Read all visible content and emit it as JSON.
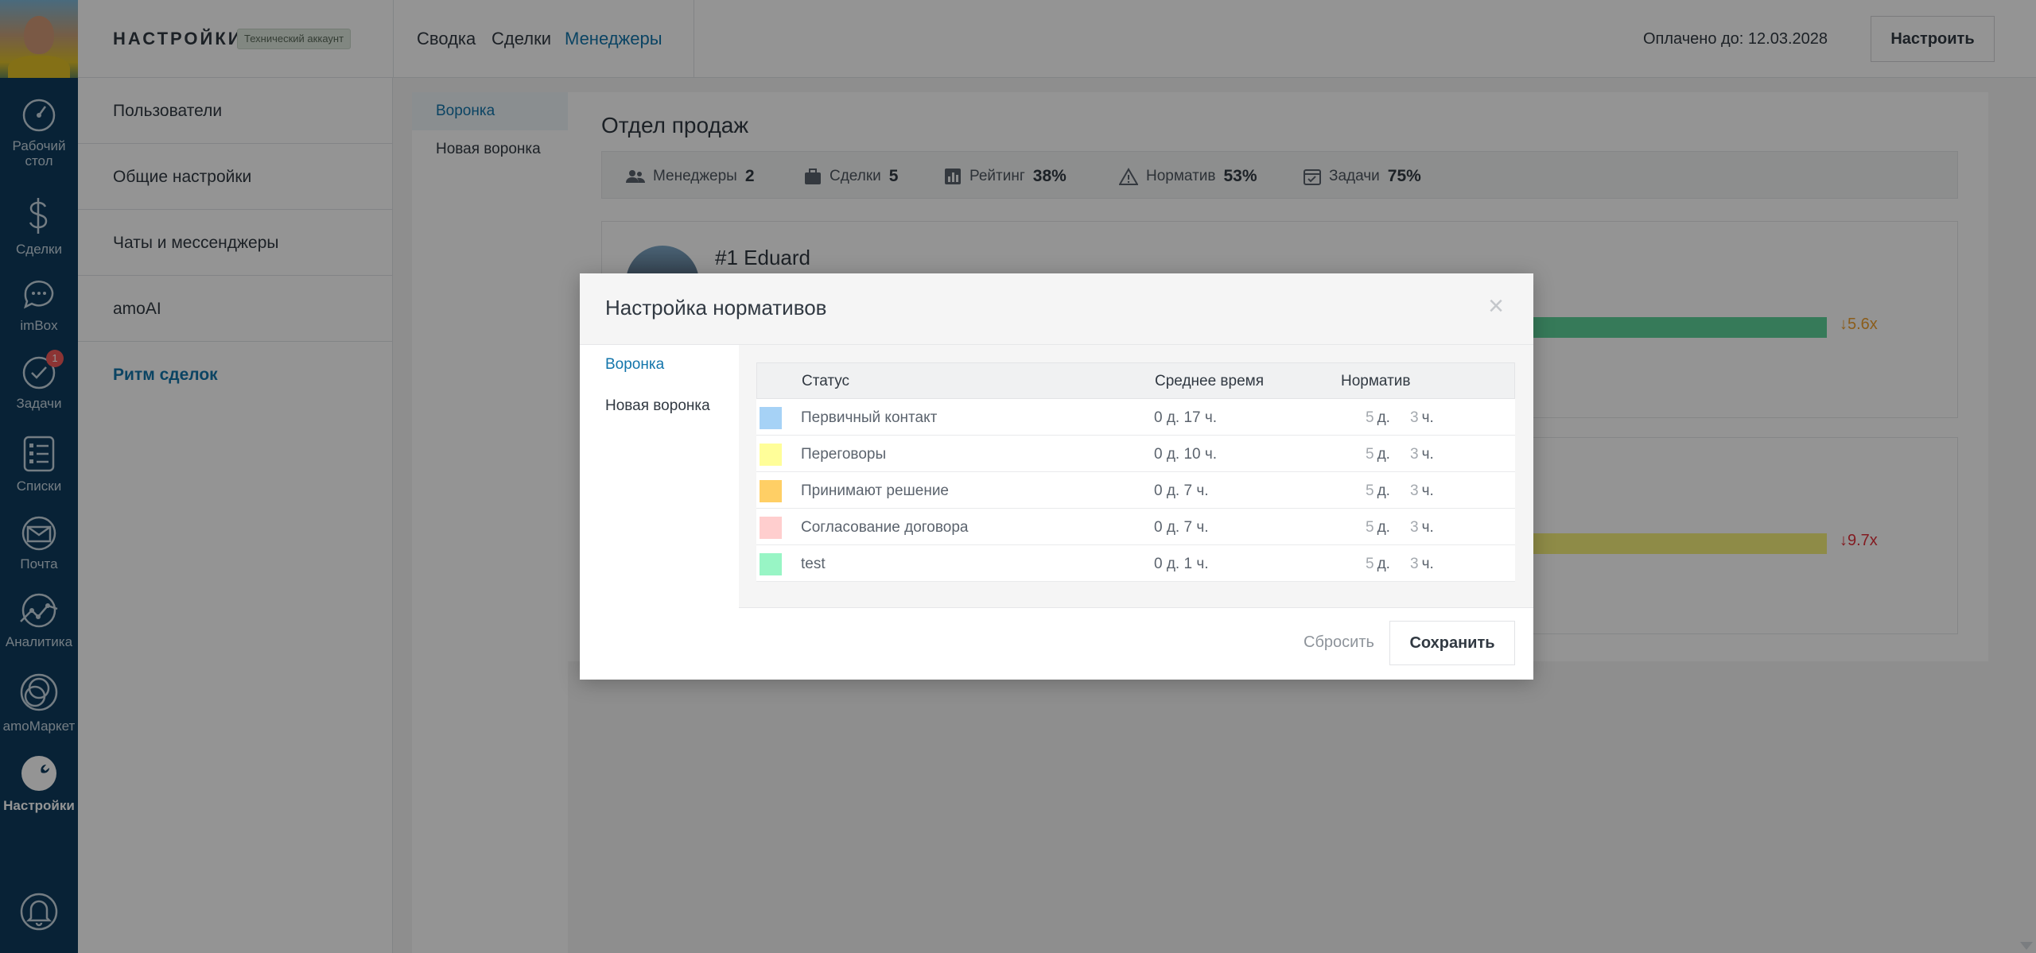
{
  "nav": {
    "items": [
      {
        "label": "Рабочий стол",
        "icon": "dashboard-gauge-icon"
      },
      {
        "label": "Сделки",
        "icon": "dollar-icon"
      },
      {
        "label": "imBox",
        "icon": "chat-bubble-icon"
      },
      {
        "label": "Задачи",
        "icon": "check-circle-icon",
        "badge": "1"
      },
      {
        "label": "Списки",
        "icon": "list-icon"
      },
      {
        "label": "Почта",
        "icon": "mail-icon"
      },
      {
        "label": "Аналитика",
        "icon": "analytics-icon"
      },
      {
        "label": "amoМаркет",
        "icon": "market-icon"
      },
      {
        "label": "Настройки",
        "icon": "wrench-icon"
      }
    ],
    "bell_icon": "bell-icon"
  },
  "header": {
    "title": "НАСТРОЙКИ",
    "account_badge": "Технический аккаунт",
    "tabs": [
      "Сводка",
      "Сделки",
      "Менеджеры"
    ],
    "active_tab": "Менеджеры",
    "paid_until": "Оплачено до: 12.03.2028",
    "configure_label": "Настроить"
  },
  "settings_menu": {
    "items": [
      "Пользователи",
      "Общие настройки",
      "Чаты и мессенджеры",
      "amoAI",
      "Ритм сделок"
    ],
    "active": "Ритм сделок"
  },
  "funnels": {
    "items": [
      "Воронка",
      "Новая воронка"
    ],
    "active": "Воронка"
  },
  "department": {
    "title": "Отдел продаж",
    "stats": [
      {
        "label": "Менеджеры",
        "value": "2",
        "icon": "users-icon"
      },
      {
        "label": "Сделки",
        "value": "5",
        "icon": "briefcase-icon"
      },
      {
        "label": "Рейтинг",
        "value": "38%",
        "icon": "bar-chart-icon"
      },
      {
        "label": "Норматив",
        "value": "53%",
        "icon": "warning-icon"
      },
      {
        "label": "Задачи",
        "value": "75%",
        "icon": "calendar-check-icon"
      }
    ]
  },
  "managers": [
    {
      "name": "#1 Eduard",
      "ratio": "↓5.6x",
      "bar_color": "#5ed39a",
      "ratio_color": "#f0a030"
    },
    {
      "name": "",
      "ratio": "↓9.7x",
      "bar_color": "#f4f07a",
      "ratio_color": "#e2303a"
    }
  ],
  "modal": {
    "title": "Настройка нормативов",
    "tabs": [
      "Воронка",
      "Новая воронка"
    ],
    "active_tab": "Воронка",
    "columns": [
      "Статус",
      "Среднее время",
      "Норматив"
    ],
    "rows": [
      {
        "color": "#a6d2f6",
        "status": "Первичный контакт",
        "avg": "0 д. 17 ч.",
        "days": "5",
        "days_unit": "д.",
        "hours": "3",
        "hours_unit": "ч."
      },
      {
        "color": "#fffe99",
        "status": "Переговоры",
        "avg": "0 д. 10 ч.",
        "days": "5",
        "days_unit": "д.",
        "hours": "3",
        "hours_unit": "ч."
      },
      {
        "color": "#ffcf65",
        "status": "Принимают решение",
        "avg": "0 д. 7 ч.",
        "days": "5",
        "days_unit": "д.",
        "hours": "3",
        "hours_unit": "ч."
      },
      {
        "color": "#ffcece",
        "status": "Согласование договора",
        "avg": "0 д. 7 ч.",
        "days": "5",
        "days_unit": "д.",
        "hours": "3",
        "hours_unit": "ч."
      },
      {
        "color": "#98f5c5",
        "status": "test",
        "avg": "0 д. 1 ч.",
        "days": "5",
        "days_unit": "д.",
        "hours": "3",
        "hours_unit": "ч."
      }
    ],
    "reset_label": "Сбросить",
    "save_label": "Сохранить",
    "close_icon": "close-icon"
  }
}
